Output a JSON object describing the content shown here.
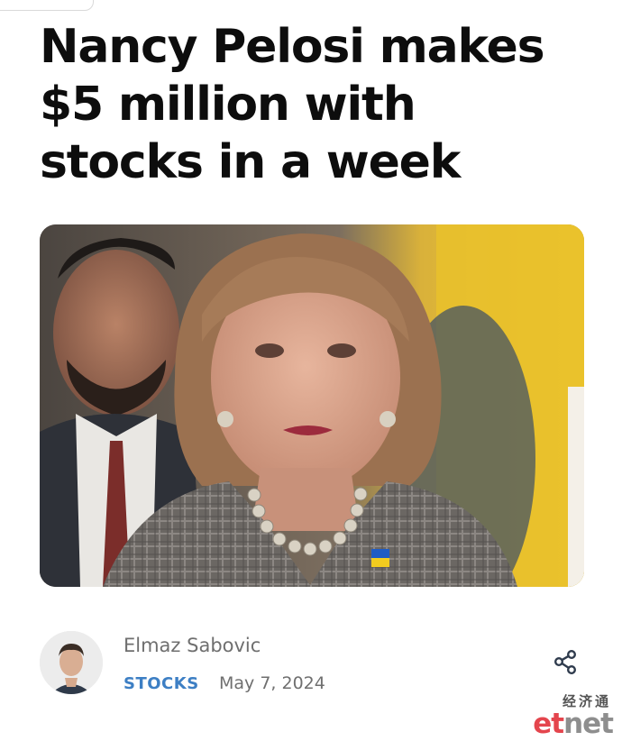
{
  "article": {
    "headline": "Nancy Pelosi makes $5 million with stocks in a week",
    "image_icon": "news-photo"
  },
  "byline": {
    "author": "Elmaz Sabovic",
    "category": "STOCKS",
    "date": "May 7, 2024",
    "share_icon": "share-icon"
  },
  "watermark": {
    "chinese": "经济通",
    "logo_et": "et",
    "logo_net": "net"
  },
  "colors": {
    "category": "#3d7fc4",
    "logo_red": "#e4454d",
    "headline": "#0d0d0d"
  }
}
